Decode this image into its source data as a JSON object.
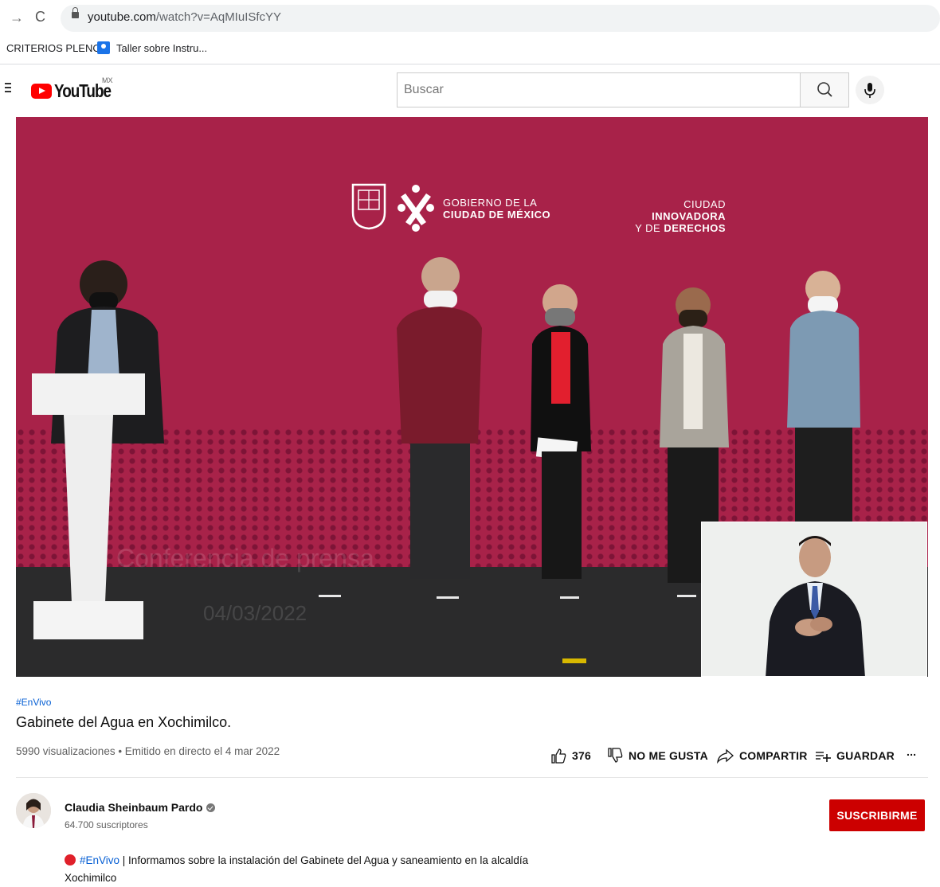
{
  "browser": {
    "url_domain": "youtube.com",
    "url_path": "/watch?v=AqMIuISfcYY",
    "bookmarks": [
      "CRITERIOS PLENO",
      "Taller sobre Instru..."
    ]
  },
  "header": {
    "logo_text": "YouTube",
    "country_code": "MX",
    "search_placeholder": "Buscar"
  },
  "video": {
    "logo_line1": "GOBIERNO DE LA",
    "logo_line2": "CIUDAD DE MÉXICO",
    "slogan_line1_a": "CIUDAD ",
    "slogan_line1_b": "INNOVADORA",
    "slogan_line2_a": "Y DE ",
    "slogan_line2_b": "DERECHOS",
    "watermark_title": "Conferencia de prensa",
    "watermark_date": "04/03/2022"
  },
  "info": {
    "hashtag": "#EnVivo",
    "title": "Gabinete del Agua en Xochimilco.",
    "meta": "5990 visualizaciones • Emitido en directo el 4 mar 2022",
    "actions": {
      "likes": "376",
      "dislike": "NO ME GUSTA",
      "share": "COMPARTIR",
      "save": "GUARDAR",
      "more": "..."
    }
  },
  "channel": {
    "name": "Claudia Sheinbaum Pardo",
    "subscribers": "64.700 suscriptores",
    "subscribe_label": "SUSCRIBIRME"
  },
  "description": {
    "hashtag": "#EnVivo",
    "text": " | Informamos sobre la instalación del Gabinete del Agua y saneamiento en la alcaldía Xochimilco"
  },
  "colors": {
    "brand_red": "#ff0000",
    "subscribe_red": "#cc0000",
    "video_backdrop": "#a82249",
    "link_blue": "#065fd4"
  }
}
